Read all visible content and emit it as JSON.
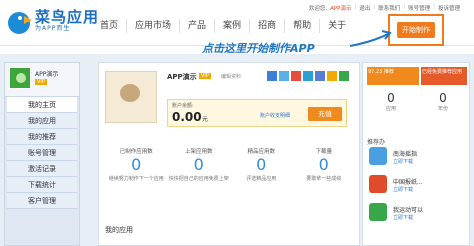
{
  "logo": {
    "title": "菜鸟应用",
    "subtitle": "为APP而生"
  },
  "utility": {
    "welcome": "欢迎您,",
    "user": "APP演示",
    "items": [
      "退出",
      "联系我们",
      "账号管理",
      "投诉管理"
    ]
  },
  "nav": {
    "items": [
      "首页",
      "应用市场",
      "产品",
      "案例",
      "招商",
      "帮助",
      "关于"
    ]
  },
  "start_button": "开始制作",
  "annotation": "点击这里开始制作APP",
  "profile": {
    "name": "APP演示",
    "badge": "VIP"
  },
  "menu": [
    "我的主页",
    "我的应用",
    "我的推荐",
    "账号管理",
    "激活记录",
    "下载统计",
    "客户管理"
  ],
  "app": {
    "name": "APP演示",
    "badge": "VIP",
    "links": "编辑资料"
  },
  "balance": {
    "label": "账户余额:",
    "amount": "0.00",
    "unit": "元",
    "detail": "账户收支明细",
    "recharge": "充值"
  },
  "stats": [
    {
      "title": "已制作应用数",
      "value": "0",
      "desc": "继续努力制作下一个应用"
    },
    {
      "title": "上架应用数",
      "value": "0",
      "desc": "快快把自己的应用免费上架"
    },
    {
      "title": "精品应用数",
      "value": "0",
      "desc": "评选精品应用"
    },
    {
      "title": "下载量",
      "value": "0",
      "desc": "要敢拿一些成绩"
    }
  ],
  "myapps_title": "我的应用",
  "right": {
    "ticket_a": "97.23 推荐",
    "ticket_b": "已经免费推荐应用",
    "stats": [
      {
        "value": "0",
        "label": "应用"
      },
      {
        "value": "0",
        "label": "年份"
      }
    ],
    "rec_title": "推荐办",
    "recs": [
      {
        "name": "南海摇指",
        "btn": "立即下载"
      },
      {
        "name": "中国报纸...",
        "btn": "立即下载"
      },
      {
        "name": "我运动可以",
        "btn": "立即下载"
      }
    ]
  }
}
